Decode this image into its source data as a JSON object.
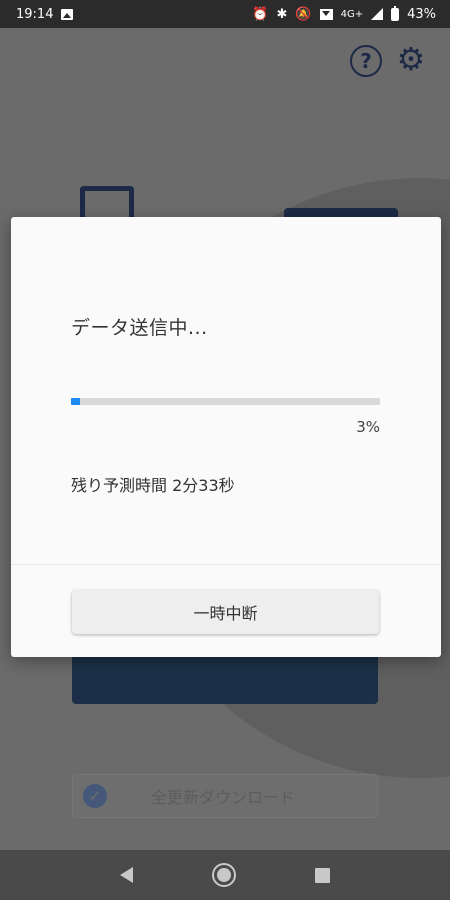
{
  "status_bar": {
    "time": "19:14",
    "network": "4G+",
    "battery": "43%"
  },
  "icons": {
    "help": "help-circle-icon",
    "settings": "gear-icon",
    "check": "check-circle-icon"
  },
  "colors": {
    "accent": "#1e8bf5",
    "brand_dark": "#1c2a47"
  },
  "background": {
    "full_update_label": "全更新ダウンロード"
  },
  "dialog": {
    "title": "データ送信中...",
    "progress_percent": "3%",
    "progress_value": 3,
    "remaining_time": "残り予測時間 2分33秒",
    "pause_button": "一時中断"
  }
}
